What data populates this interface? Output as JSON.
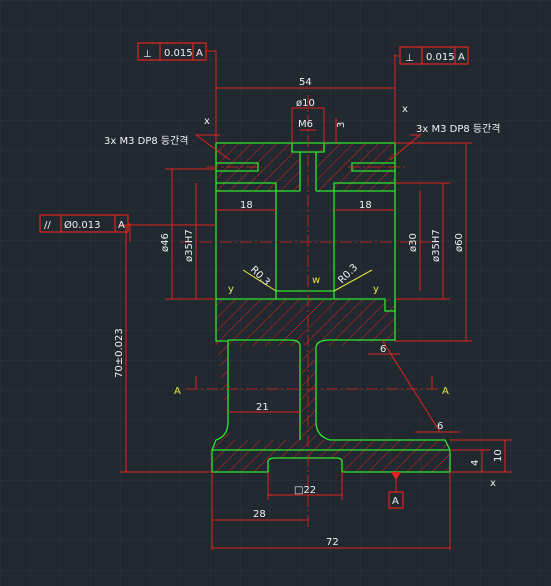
{
  "colors": {
    "background": "#212830",
    "grid": "#2b333d",
    "dimension": "#e0241b",
    "geometry": "#2ee82e",
    "text": "#f2f2f2",
    "hatch": "#e0241b",
    "label": "#e8e83a"
  },
  "tolerance_frames": {
    "top_left": {
      "symbol": "⊥",
      "value": "0.015",
      "datum": "A"
    },
    "top_right": {
      "symbol": "⊥",
      "value": "0.015",
      "datum": "A"
    },
    "parallel": {
      "symbol": "//",
      "value": "Ø0.013",
      "datum": "A"
    }
  },
  "dimensions": {
    "overall_width_top": "54",
    "bore_top": "ø10",
    "thread": "M6",
    "thread_depth": "3",
    "hole_note_left": "3x M3 DP8 등간격",
    "hole_note_right": "3x M3 DP8 등간격",
    "left_width": "18",
    "right_width": "18",
    "dia_46": "ø46",
    "dia_35h7_left": "ø35H7",
    "dia_30": "ø30",
    "dia_35h7_right": "ø35H7",
    "dia_60": "ø60",
    "fillet_left": "R0.3",
    "fillet_right": "R0.3",
    "height_70": "70±0.023",
    "neck_gap": "6",
    "neck_width": "21",
    "base_step": "6",
    "base_h10": "10",
    "base_h4": "4",
    "square_22": "□22",
    "offset_28": "28",
    "overall_width_bottom": "72"
  },
  "section_labels": {
    "left": "A",
    "right": "A",
    "datum_box": "A"
  },
  "marks": {
    "roughness_x": "x",
    "roughness_y": "y",
    "roughness_w": "w"
  }
}
